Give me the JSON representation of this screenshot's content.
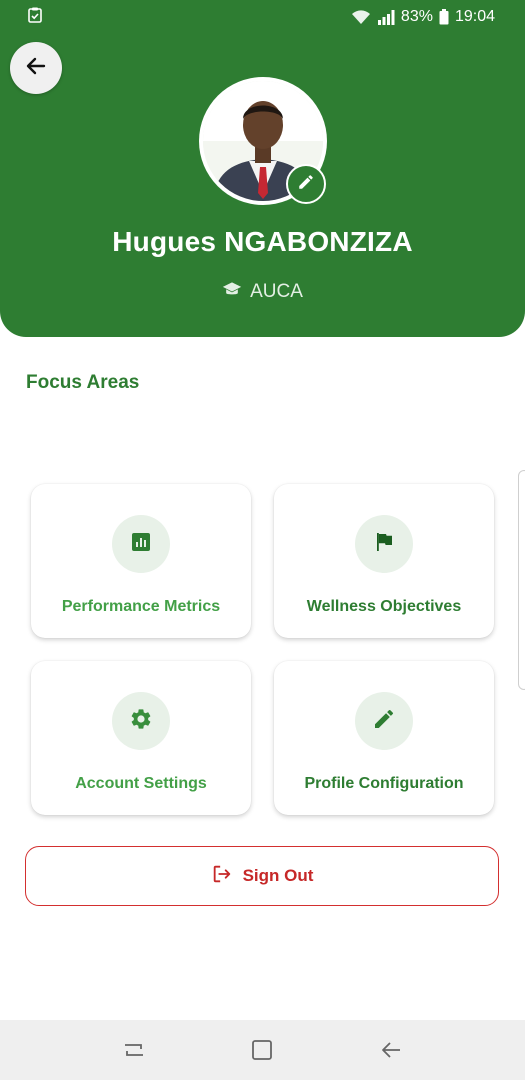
{
  "status_bar": {
    "battery": "83%",
    "time": "19:04",
    "icons": [
      "clipboard-check-icon",
      "wifi-icon",
      "signal-icon",
      "battery-icon"
    ]
  },
  "header": {
    "back_icon": "arrow-left-icon",
    "avatar_edit_icon": "pencil-icon",
    "name": "Hugues NGABONZIZA",
    "institution_icon": "graduation-cap-icon",
    "institution": "AUCA"
  },
  "focus": {
    "title": "Focus Areas",
    "cards": [
      {
        "label": "Performance Metrics",
        "icon": "bar-chart-icon"
      },
      {
        "label": "Wellness Objectives",
        "icon": "flag-icon"
      },
      {
        "label": "Account Settings",
        "icon": "gear-icon"
      },
      {
        "label": "Profile Configuration",
        "icon": "pencil-icon"
      }
    ]
  },
  "signout": {
    "label": "Sign Out",
    "icon": "logout-icon"
  },
  "colors": {
    "primary": "#2e7d32",
    "primary_light": "#43a047",
    "danger": "#d32f2f",
    "icon_bg": "#e8f1e8"
  },
  "nav": {
    "icons": [
      "recent-apps-icon",
      "home-icon",
      "back-icon"
    ]
  }
}
